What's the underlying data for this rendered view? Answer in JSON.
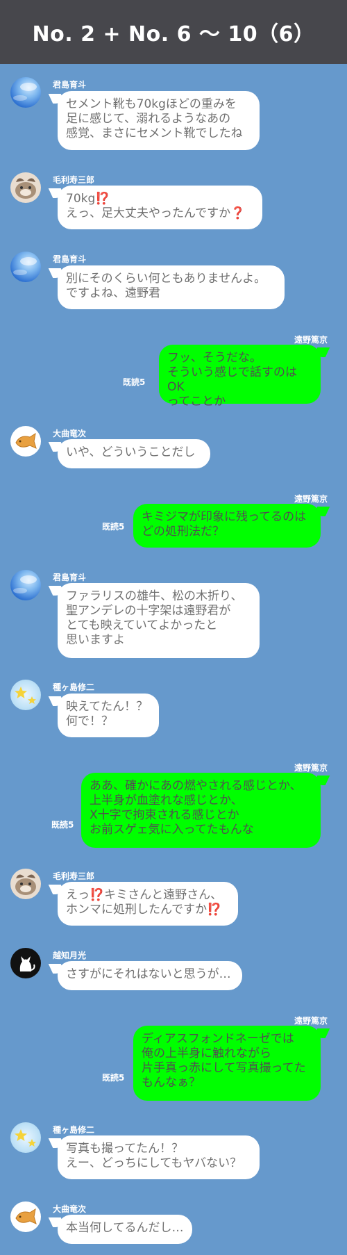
{
  "header": {
    "title": "No. 2 + No. 6 ～ 10（6）"
  },
  "messages": [
    {
      "sender": "君島育斗",
      "avatar": "sky-avatar",
      "text": "セメント靴も70kgほどの重みを\n足に感じて、溺れるようなあの\n感覚、まさにセメント靴でしたね"
    },
    {
      "sender": "毛利寿三郎",
      "avatar": "dog-avatar",
      "text": "70kg⁉️\nえっ、足大丈夫やったんですか❓"
    },
    {
      "sender": "君島育斗",
      "avatar": "sky-avatar",
      "text": "別にそのくらい何ともありませんよ。\nですよね、遠野君"
    },
    {
      "sender": "遠野篤京",
      "mine": true,
      "read": "既読5",
      "text": "フッ、そうだな。\nそういう感じで話すのはOK\nってことか"
    },
    {
      "sender": "大曲竜次",
      "avatar": "taiyaki-avatar",
      "text": "いや、どういうことだし"
    },
    {
      "sender": "遠野篤京",
      "mine": true,
      "read": "既読5",
      "text": "キミジマが印象に残ってるのは\nどの処刑法だ？"
    },
    {
      "sender": "君島育斗",
      "avatar": "sky-avatar",
      "text": "ファラリスの雄牛、松の木折り、\n聖アンデレの十字架は遠野君が\nとても映えていてよかったと\n思いますよ"
    },
    {
      "sender": "種ヶ島修二",
      "avatar": "star-avatar",
      "text": "映えてたん！？\n何で！？"
    },
    {
      "sender": "遠野篤京",
      "mine": true,
      "read": "既読5",
      "text": "ああ、確かにあの燃やされる感じとか、\n上半身が血塗れな感じとか、\nX十字で拘束される感じとか\nお前スゲェ気に入ってたもんな"
    },
    {
      "sender": "毛利寿三郎",
      "avatar": "dog-avatar",
      "text": "えっ⁉️キミさんと遠野さん、\nホンマに処刑したんですか⁉️"
    },
    {
      "sender": "越知月光",
      "avatar": "cat-avatar",
      "text": "さすがにそれはないと思うが…"
    },
    {
      "sender": "遠野篤京",
      "mine": true,
      "read": "既読5",
      "text": "ディアスフォンドネーゼでは\n俺の上半身に触れながら\n片手真っ赤にして写真撮ってた\nもんなぁ？"
    },
    {
      "sender": "種ヶ島修二",
      "avatar": "star-avatar",
      "text": "写真も撮ってたん！？\nえー、どっちにしてもヤバない？"
    },
    {
      "sender": "大曲竜次",
      "avatar": "taiyaki-avatar",
      "text": "本当何してるんだし…"
    }
  ]
}
